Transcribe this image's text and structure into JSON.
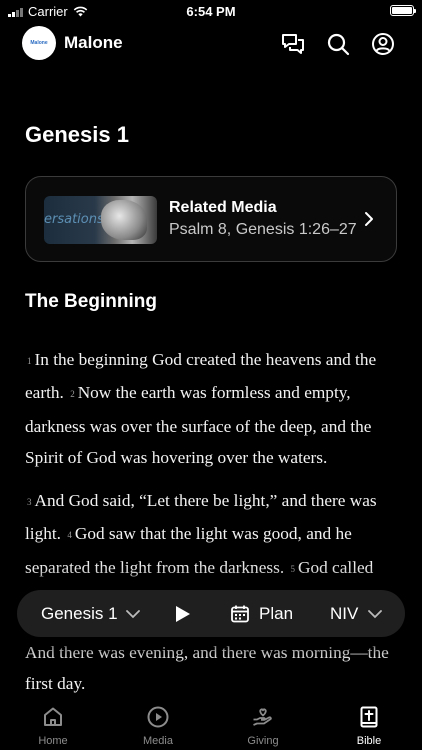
{
  "status_bar": {
    "carrier": "Carrier",
    "time": "6:54 PM"
  },
  "header": {
    "avatar_text": "Malone",
    "app_name": "Malone"
  },
  "chapter": {
    "title": "Genesis 1"
  },
  "related_media": {
    "label": "Related Media",
    "references": "Psalm 8, Genesis 1:26–27",
    "thumbnail_text": "ersations"
  },
  "section": {
    "heading": "The Beginning"
  },
  "verses": {
    "v1": {
      "num": "1",
      "text": "In the beginning God created the heavens and the earth."
    },
    "v2": {
      "num": "2",
      "text": "Now the earth was formless and empty, darkness was over the surface of the deep, and the Spirit of God was hovering over the waters."
    },
    "v3": {
      "num": "3",
      "text": "And God said, “Let there be light,” and there was light."
    },
    "v4": {
      "num": "4",
      "text": "God saw that the light was good, and he separated the light from the darkness."
    },
    "v5": {
      "num": "5",
      "text": "God called"
    },
    "v5_end": "And there was evening, and there was morning—the first day."
  },
  "reader_bar": {
    "chapter_select": "Genesis 1",
    "plan_label": "Plan",
    "version_select": "NIV"
  },
  "tabs": [
    {
      "label": "Home",
      "icon": "home-icon"
    },
    {
      "label": "Media",
      "icon": "play-circle-icon"
    },
    {
      "label": "Giving",
      "icon": "giving-hand-icon"
    },
    {
      "label": "Bible",
      "icon": "bible-icon"
    }
  ],
  "active_tab": "Bible"
}
